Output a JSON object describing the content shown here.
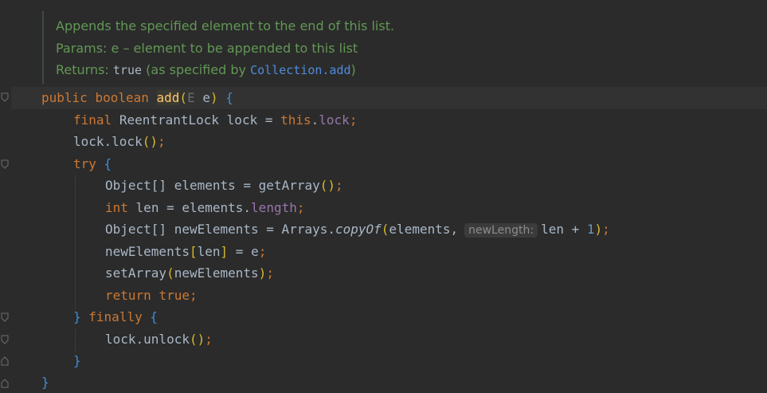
{
  "doc": {
    "line1": "Appends the specified element to the end of this list.",
    "params_label": "Params:",
    "params_text": "e – element to be appended to this list",
    "returns_label": "Returns:",
    "returns_code": "true",
    "returns_mid": "(as specified by",
    "returns_link": "Collection.add",
    "returns_end": ")"
  },
  "code": {
    "l1_public": "public",
    "l1_boolean": "boolean",
    "l1_name": "add",
    "l1_open": "(",
    "l1_type": "E",
    "l1_param": "e",
    "l1_close": ")",
    "l1_brace": "{",
    "l2_final": "final",
    "l2_type": "ReentrantLock lock =",
    "l2_this": "this",
    "l2_dot": ".",
    "l2_field": "lock",
    "l2_semi": ";",
    "l3_text": "lock.lock",
    "l3_parens": "()",
    "l3_semi": ";",
    "l4_try": "try",
    "l4_brace": "{",
    "l5_text": "Object[] elements =",
    "l5_call": "getArray",
    "l5_parens": "()",
    "l5_semi": ";",
    "l6_int": "int",
    "l6_text": "len = elements.",
    "l6_field": "length",
    "l6_semi": ";",
    "l7_text": "Object[] newElements = Arrays.",
    "l7_call": "copyOf",
    "l7_open": "(",
    "l7_arg": "elements,",
    "l7_hint": "newLength:",
    "l7_rest": "len +",
    "l7_num": "1",
    "l7_close": ")",
    "l7_semi": ";",
    "l8_text": "newElements",
    "l8_open": "[",
    "l8_idx": "len",
    "l8_close": "]",
    "l8_rest": "= e",
    "l8_semi": ";",
    "l9_text": "setArray",
    "l9_open": "(",
    "l9_arg": "newElements",
    "l9_close": ")",
    "l9_semi": ";",
    "l10_return": "return",
    "l10_true": "true",
    "l10_semi": ";",
    "l11_close": "}",
    "l11_finally": "finally",
    "l11_brace": "{",
    "l12_text": "lock.unlock",
    "l12_parens": "()",
    "l12_semi": ";",
    "l13_close": "}",
    "l14_close": "}"
  },
  "colors": {
    "background": "#2b2b2b",
    "keyword": "#cc7832",
    "method": "#ffc66d",
    "field": "#9876aa",
    "number": "#6897bb",
    "doc_comment": "#629755",
    "bracket": "#d7ba2e",
    "brace": "#3f8fd6"
  },
  "icons": [
    "fold-marker-icon"
  ]
}
